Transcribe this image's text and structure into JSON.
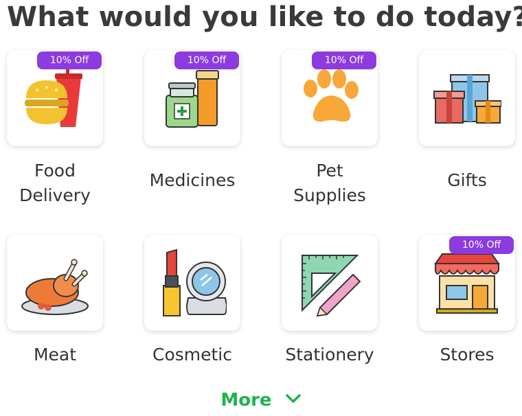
{
  "header": {
    "title": "What would you like to do today?"
  },
  "services": [
    {
      "label_line1": "Food",
      "label_line2": "Delivery",
      "badge": "10% Off",
      "icon": "burger-drink-icon"
    },
    {
      "label_line1": "Medicines",
      "label_line2": "",
      "badge": "10% Off",
      "icon": "medicine-bottles-icon"
    },
    {
      "label_line1": "Pet",
      "label_line2": "Supplies",
      "badge": "10% Off",
      "icon": "paw-icon"
    },
    {
      "label_line1": "Gifts",
      "label_line2": "",
      "badge": "",
      "icon": "gift-boxes-icon"
    },
    {
      "label_line1": "Meat",
      "label_line2": "",
      "badge": "",
      "icon": "roast-chicken-icon"
    },
    {
      "label_line1": "Cosmetic",
      "label_line2": "",
      "badge": "",
      "icon": "lipstick-compact-icon"
    },
    {
      "label_line1": "Stationery",
      "label_line2": "",
      "badge": "",
      "icon": "ruler-pencil-icon"
    },
    {
      "label_line1": "Stores",
      "label_line2": "",
      "badge": "10% Off",
      "icon": "storefront-icon"
    }
  ],
  "more": {
    "label": "More"
  },
  "colors": {
    "badge": "#8b3be0",
    "more": "#1fb350"
  }
}
